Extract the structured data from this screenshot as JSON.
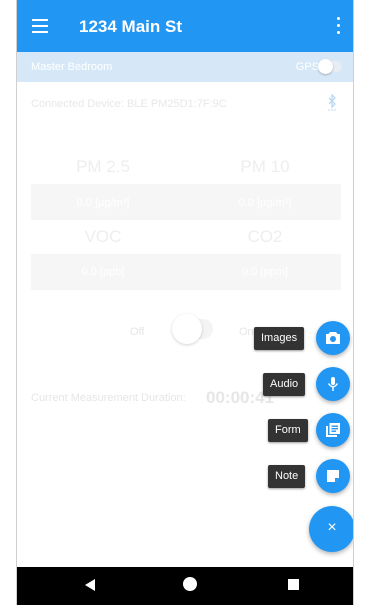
{
  "header": {
    "title": "1234 Main St"
  },
  "subbar": {
    "room": "Master Bedroom",
    "gps_label": "GPS"
  },
  "device": {
    "label": "Connected Device:",
    "name": "BLE PM25D1:7F:9C"
  },
  "sensors": [
    {
      "label": "PM 2.5",
      "value": "0.0 [µg/m³]"
    },
    {
      "label": "PM 10",
      "value": "0.0 [µg/m³]"
    },
    {
      "label": "VOC",
      "value": "0.0 [ppb]"
    },
    {
      "label": "CO2",
      "value": "0.0 [ppm]"
    }
  ],
  "toggle": {
    "off_label": "Off",
    "on_label": "On"
  },
  "duration": {
    "label": "Current Measurement Duration:",
    "value": "00:00:41"
  },
  "fab_menu": {
    "items": [
      {
        "label": "Images",
        "icon": "camera-icon"
      },
      {
        "label": "Audio",
        "icon": "microphone-icon"
      },
      {
        "label": "Form",
        "icon": "form-icon"
      },
      {
        "label": "Note",
        "icon": "note-icon"
      }
    ],
    "close_label": "×"
  },
  "colors": {
    "primary": "#2196f3",
    "chip": "#333333",
    "navbar": "#000000"
  }
}
